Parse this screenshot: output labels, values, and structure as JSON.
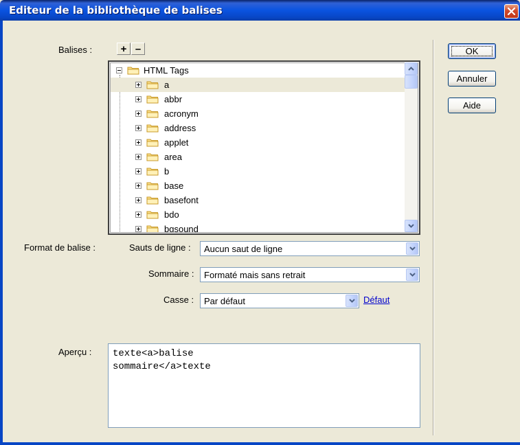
{
  "window": {
    "title": "Editeur de la bibliothèque de balises"
  },
  "tags_section": {
    "label": "Balises :",
    "add_label": "+",
    "remove_label": "–",
    "tree": {
      "root": "HTML Tags",
      "items": [
        "a",
        "abbr",
        "acronym",
        "address",
        "applet",
        "area",
        "b",
        "base",
        "basefont",
        "bdo",
        "bgsound"
      ],
      "selected": "a"
    }
  },
  "format_section": {
    "label": "Format de balise :",
    "line_breaks": {
      "label": "Sauts de ligne :",
      "value": "Aucun saut de ligne"
    },
    "contents": {
      "label": "Sommaire :",
      "value": "Formaté mais sans retrait"
    },
    "case": {
      "label": "Casse :",
      "value": "Par défaut",
      "link": "Défaut"
    }
  },
  "preview": {
    "label": "Aperçu :",
    "lines": [
      "texte<a>balise",
      "sommaire</a>texte"
    ]
  },
  "buttons": {
    "ok": "OK",
    "cancel": "Annuler",
    "help": "Aide"
  },
  "colors": {
    "titlebar": "#0A53E0",
    "dialog_bg": "#ECE9D8",
    "link": "#0000CC"
  }
}
